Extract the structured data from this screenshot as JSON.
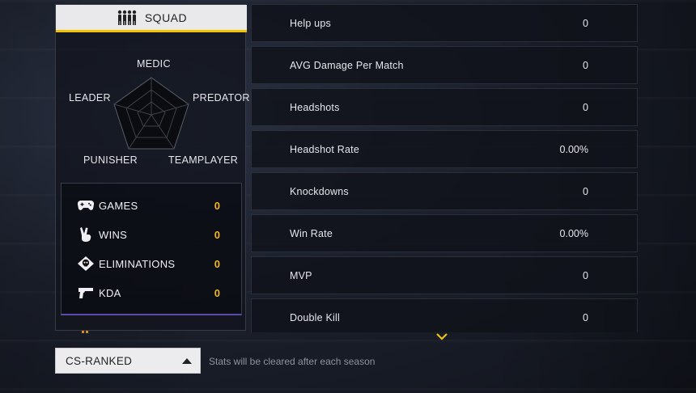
{
  "left_panel": {
    "mode_title": "SQUAD",
    "radar_labels": {
      "top": "MEDIC",
      "left": "LEADER",
      "right": "PREDATOR",
      "bottom_left": "PUNISHER",
      "bottom_right": "TEAMPLAYER"
    },
    "summary": [
      {
        "icon": "gamepad-icon",
        "label": "GAMES",
        "value": "0"
      },
      {
        "icon": "victory-hand-icon",
        "label": "WINS",
        "value": "0"
      },
      {
        "icon": "skull-icon",
        "label": "ELIMINATIONS",
        "value": "0"
      },
      {
        "icon": "pistol-icon",
        "label": "KDA",
        "value": "0"
      }
    ]
  },
  "stats": [
    {
      "label": "Help ups",
      "value": "0"
    },
    {
      "label": "AVG Damage Per Match",
      "value": "0"
    },
    {
      "label": "Headshots",
      "value": "0"
    },
    {
      "label": "Headshot Rate",
      "value": "0.00%"
    },
    {
      "label": "Knockdowns",
      "value": "0"
    },
    {
      "label": "Win Rate",
      "value": "0.00%"
    },
    {
      "label": "MVP",
      "value": "0"
    },
    {
      "label": "Double Kill",
      "value": "0"
    }
  ],
  "bottom_bar": {
    "mode_select_value": "CS-RANKED",
    "season_note": "Stats will be cleared after each season"
  },
  "colors": {
    "accent_yellow": "#f2c200",
    "value_orange": "#f2b51c",
    "purple_line": "#5b4aa8"
  }
}
